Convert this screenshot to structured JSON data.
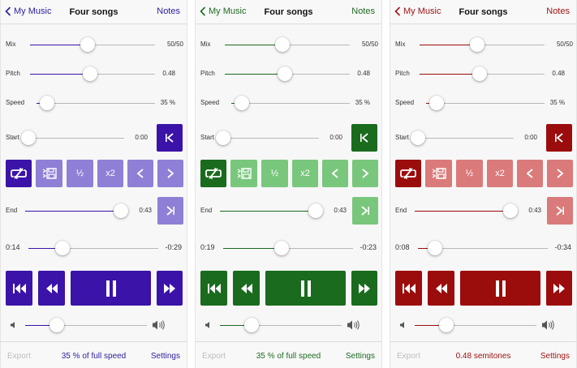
{
  "panels": [
    {
      "theme": {
        "accent": "#3b13a8",
        "light": "#8f7fd6",
        "text": "#2a1ea0"
      },
      "nav": {
        "back": "My Music",
        "title": "Four songs",
        "notes": "Notes"
      },
      "mix": {
        "label": "Mix",
        "value": "50/50",
        "pos": 0.46
      },
      "pitch": {
        "label": "Pitch",
        "value": "0.48",
        "pos": 0.48
      },
      "speed": {
        "label": "Speed",
        "value": "35 %",
        "pos": 0.09
      },
      "start": {
        "label": "Start",
        "value": "0:00",
        "pos": 0.0
      },
      "end": {
        "label": "End",
        "value": "0:43",
        "pos": 1.0
      },
      "tool_labels": {
        "half": "½",
        "double": "x2"
      },
      "progress": {
        "elapsed": "0:14",
        "remaining": "-0:29",
        "pos": 0.26
      },
      "volume": {
        "pos": 0.26
      },
      "footer": {
        "export": "Export",
        "status": "35 % of full speed",
        "settings": "Settings"
      }
    },
    {
      "theme": {
        "accent": "#1a6b1e",
        "light": "#79c77c",
        "text": "#1e6b22"
      },
      "nav": {
        "back": "My Music",
        "title": "Four songs",
        "notes": "Notes"
      },
      "mix": {
        "label": "Mix",
        "value": "50/50",
        "pos": 0.46
      },
      "pitch": {
        "label": "Pitch",
        "value": "0.48",
        "pos": 0.48
      },
      "speed": {
        "label": "Speed",
        "value": "35 %",
        "pos": 0.09
      },
      "start": {
        "label": "Start",
        "value": "0:00",
        "pos": 0.0
      },
      "end": {
        "label": "End",
        "value": "0:43",
        "pos": 1.0
      },
      "tool_labels": {
        "half": "½",
        "double": "x2"
      },
      "progress": {
        "elapsed": "0:19",
        "remaining": "-0:23",
        "pos": 0.45
      },
      "volume": {
        "pos": 0.26
      },
      "footer": {
        "export": "Export",
        "status": "35 % of full speed",
        "settings": "Settings"
      }
    },
    {
      "theme": {
        "accent": "#9b0c0c",
        "light": "#db7a7a",
        "text": "#a11414"
      },
      "nav": {
        "back": "My Music",
        "title": "Four songs",
        "notes": "Notes"
      },
      "mix": {
        "label": "Mix",
        "value": "50/50",
        "pos": 0.46
      },
      "pitch": {
        "label": "Pitch",
        "value": "0.48",
        "pos": 0.48
      },
      "speed": {
        "label": "Speed",
        "value": "35 %",
        "pos": 0.09
      },
      "start": {
        "label": "Start",
        "value": "0:00",
        "pos": 0.0
      },
      "end": {
        "label": "End",
        "value": "0:43",
        "pos": 1.0
      },
      "tool_labels": {
        "half": "½",
        "double": "x2"
      },
      "progress": {
        "elapsed": "0:08",
        "remaining": "-0:34",
        "pos": 0.13
      },
      "volume": {
        "pos": 0.26
      },
      "footer": {
        "export": "Export",
        "status": "0.48 semitones",
        "settings": "Settings"
      }
    }
  ],
  "icons": [
    "chevron-left-icon",
    "skip-to-start-icon",
    "loop-icon",
    "save-loop-icon",
    "arrow-left-icon",
    "arrow-right-icon",
    "skip-to-end-icon",
    "rewind-to-start-icon",
    "rewind-icon",
    "pause-icon",
    "fast-forward-icon",
    "speaker-low-icon",
    "speaker-high-icon"
  ]
}
